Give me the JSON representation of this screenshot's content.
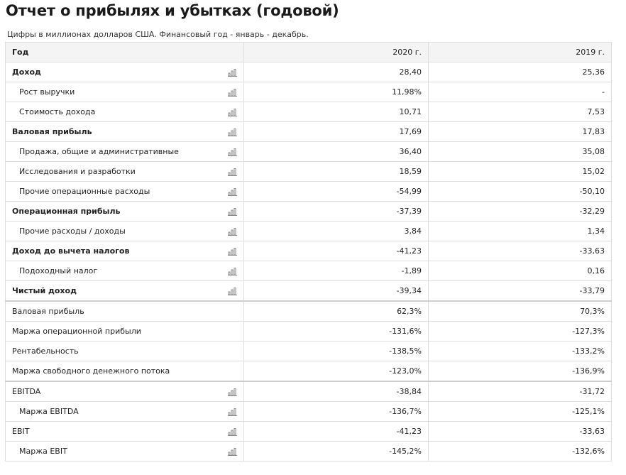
{
  "page": {
    "title": "Отчет о прибылях и убытках (годовой)",
    "subtitle": "Цифры в миллионах долларов США. Финансовый год - январь - декабрь."
  },
  "table": {
    "header": {
      "label": "Год",
      "y1": "2020 г.",
      "y2": "2019 г."
    },
    "rows": [
      {
        "label": "Доход",
        "y1": "28,40",
        "y2": "25,36"
      },
      {
        "label": "Рост выручки",
        "y1": "11,98%",
        "y2": "-"
      },
      {
        "label": "Стоимость дохода",
        "y1": "10,71",
        "y2": "7,53"
      },
      {
        "label": "Валовая прибыль",
        "y1": "17,69",
        "y2": "17,83"
      },
      {
        "label": "Продажа, общие и административные",
        "y1": "36,40",
        "y2": "35,08"
      },
      {
        "label": "Исследования и разработки",
        "y1": "18,59",
        "y2": "15,02"
      },
      {
        "label": "Прочие операционные расходы",
        "y1": "-54,99",
        "y2": "-50,10"
      },
      {
        "label": "Операционная прибыль",
        "y1": "-37,39",
        "y2": "-32,29"
      },
      {
        "label": "Прочие расходы / доходы",
        "y1": "3,84",
        "y2": "1,34"
      },
      {
        "label": "Доход до вычета налогов",
        "y1": "-41,23",
        "y2": "-33,63"
      },
      {
        "label": "Подоходный налог",
        "y1": "-1,89",
        "y2": "0,16"
      },
      {
        "label": "Чистый доход",
        "y1": "-39,34",
        "y2": "-33,79"
      },
      {
        "label": "Валовая прибыль",
        "y1": "62,3%",
        "y2": "70,3%"
      },
      {
        "label": "Маржа операционной прибыли",
        "y1": "-131,6%",
        "y2": "-127,3%"
      },
      {
        "label": "Рентабельность",
        "y1": "-138,5%",
        "y2": "-133,2%"
      },
      {
        "label": "Маржа свободного денежного потока",
        "y1": "-123,0%",
        "y2": "-136,9%"
      },
      {
        "label": "EBITDA",
        "y1": "-38,84",
        "y2": "-31,72"
      },
      {
        "label": "Маржа EBITDA",
        "y1": "-136,7%",
        "y2": "-125,1%"
      },
      {
        "label": "EBIT",
        "y1": "-41,23",
        "y2": "-33,63"
      },
      {
        "label": "Маржа EBIT",
        "y1": "-145,2%",
        "y2": "-132,6%"
      }
    ]
  },
  "icons": {
    "row_chart": "bar-chart-icon",
    "color": "#8a8a8a"
  }
}
